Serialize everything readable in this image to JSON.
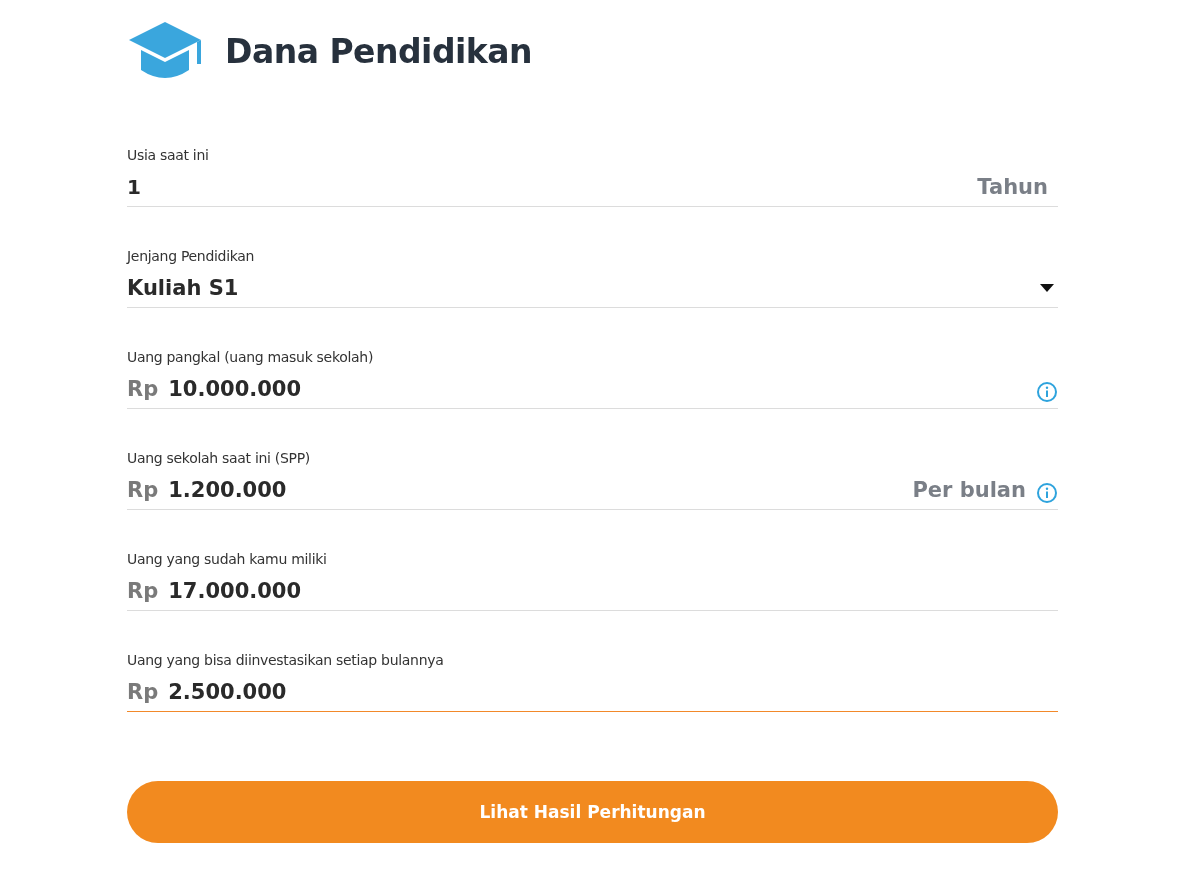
{
  "title": "Dana Pendidikan",
  "fields": [
    {
      "kind": "text",
      "label": "Usia saat ini",
      "value": "1",
      "suffix": "Tahun",
      "info": false,
      "focused": false
    },
    {
      "kind": "select",
      "label": "Jenjang Pendidikan",
      "value": "Kuliah S1",
      "info": false,
      "focused": false
    },
    {
      "kind": "currency",
      "label": "Uang pangkal (uang masuk sekolah)",
      "prefix": "Rp",
      "value": "10.000.000",
      "info": true,
      "focused": false
    },
    {
      "kind": "currency",
      "label": "Uang sekolah saat ini (SPP)",
      "prefix": "Rp",
      "value": "1.200.000",
      "suffix": "Per bulan",
      "info": true,
      "focused": false
    },
    {
      "kind": "currency",
      "label": "Uang yang sudah kamu miliki",
      "prefix": "Rp",
      "value": "17.000.000",
      "info": false,
      "focused": false
    },
    {
      "kind": "currency",
      "label": "Uang yang bisa diinvestasikan setiap bulannya",
      "prefix": "Rp",
      "value": "2.500.000",
      "info": false,
      "focused": true
    }
  ],
  "button": {
    "label": "Lihat Hasil Perhitungan"
  }
}
